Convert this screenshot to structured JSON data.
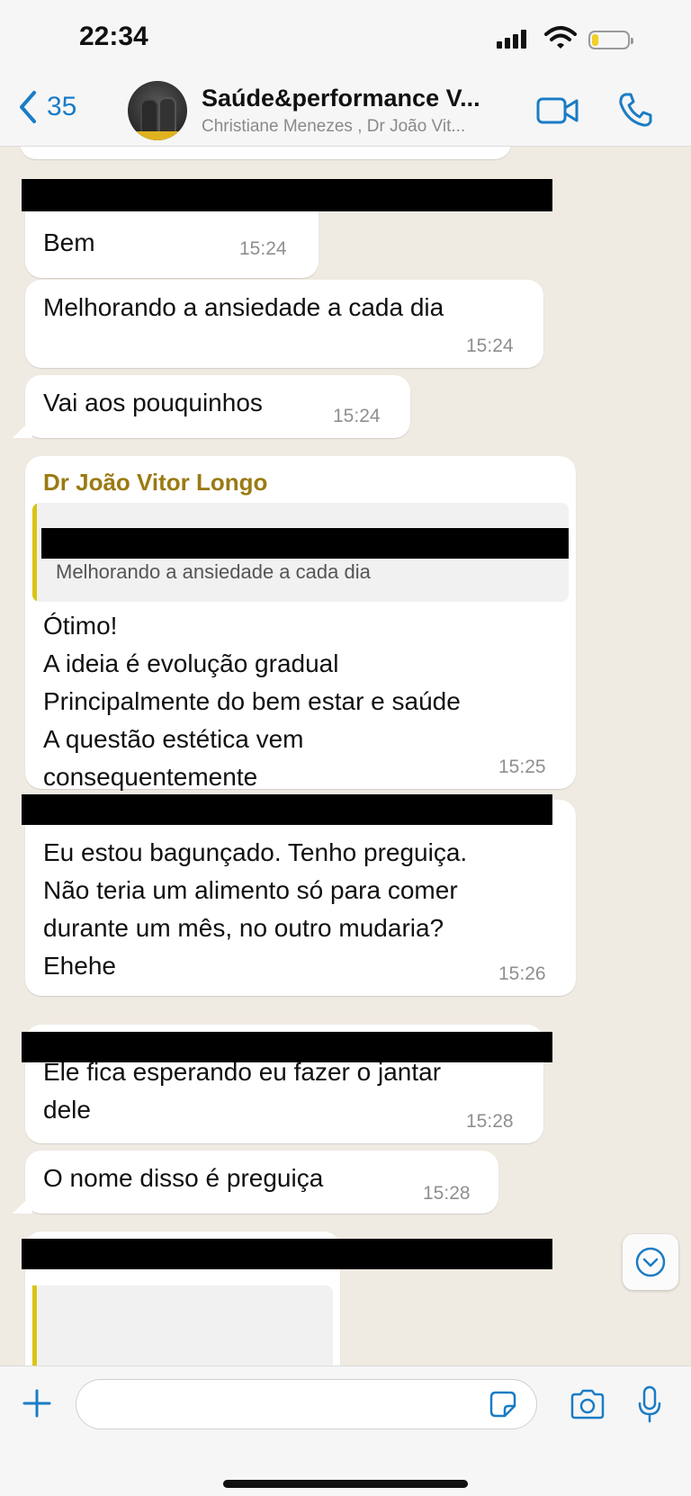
{
  "status_bar": {
    "time": "22:34",
    "battery_color": "#f2cf27"
  },
  "header": {
    "back_count": "35",
    "title": "Saúde&performance V...",
    "subtitle": "Christiane Menezes , Dr João Vit...",
    "icons": [
      "chevron-left-icon",
      "group-avatar",
      "video-call-icon",
      "phone-icon"
    ]
  },
  "messages": [
    {
      "text": "Bem",
      "time": "15:24"
    },
    {
      "text": "Melhorando a ansiedade a cada dia",
      "time": "15:24"
    },
    {
      "text": "Vai aos pouquinhos",
      "time": "15:24"
    },
    {
      "sender": "Dr João Vitor Longo",
      "quote_text": "Melhorando a ansiedade a cada dia",
      "text": "Ótimo!\nA ideia é evolução gradual\nPrincipalmente do bem estar e saúde\nA questão estética vem\nconsequentemente",
      "time": "15:25"
    },
    {
      "text": "Eu estou bagunçado. Tenho preguiça.\nNão teria um alimento só para comer\ndurante um mês, no outro mudaria?\nEhehe",
      "time": "15:26"
    },
    {
      "text": "Ele fica esperando eu fazer o jantar\ndele",
      "time": "15:28"
    },
    {
      "text": "O nome disso é preguiça",
      "time": "15:28"
    }
  ],
  "colors": {
    "sender_name": "#9b7a12",
    "quote_bar": "#d9c414",
    "accent": "#1a7cc5"
  },
  "composer": {
    "placeholder": ""
  }
}
